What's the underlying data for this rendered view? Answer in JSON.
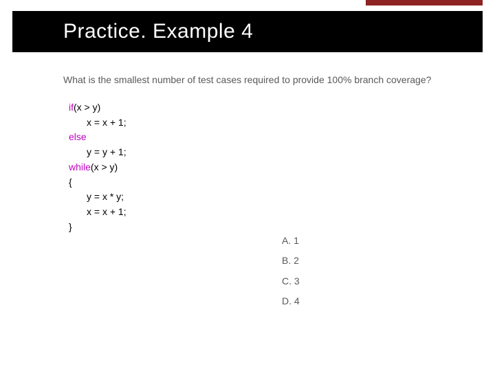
{
  "title": "Practice. Example 4",
  "question": "What is the smallest number of test cases required to provide 100% branch coverage?",
  "code": {
    "kw_if": "if",
    "cond1": "(x > y)",
    "line2": "x = x + 1;",
    "kw_else": "else",
    "line4": "y = y + 1;",
    "kw_while": "while",
    "cond2": "(x > y)",
    "brace_open": "{",
    "line7": "y = x * y;",
    "line8": "x = x + 1;",
    "brace_close": "}"
  },
  "answers": {
    "a": "A. 1",
    "b": "B. 2",
    "c": "C. 3",
    "d": "D. 4"
  }
}
